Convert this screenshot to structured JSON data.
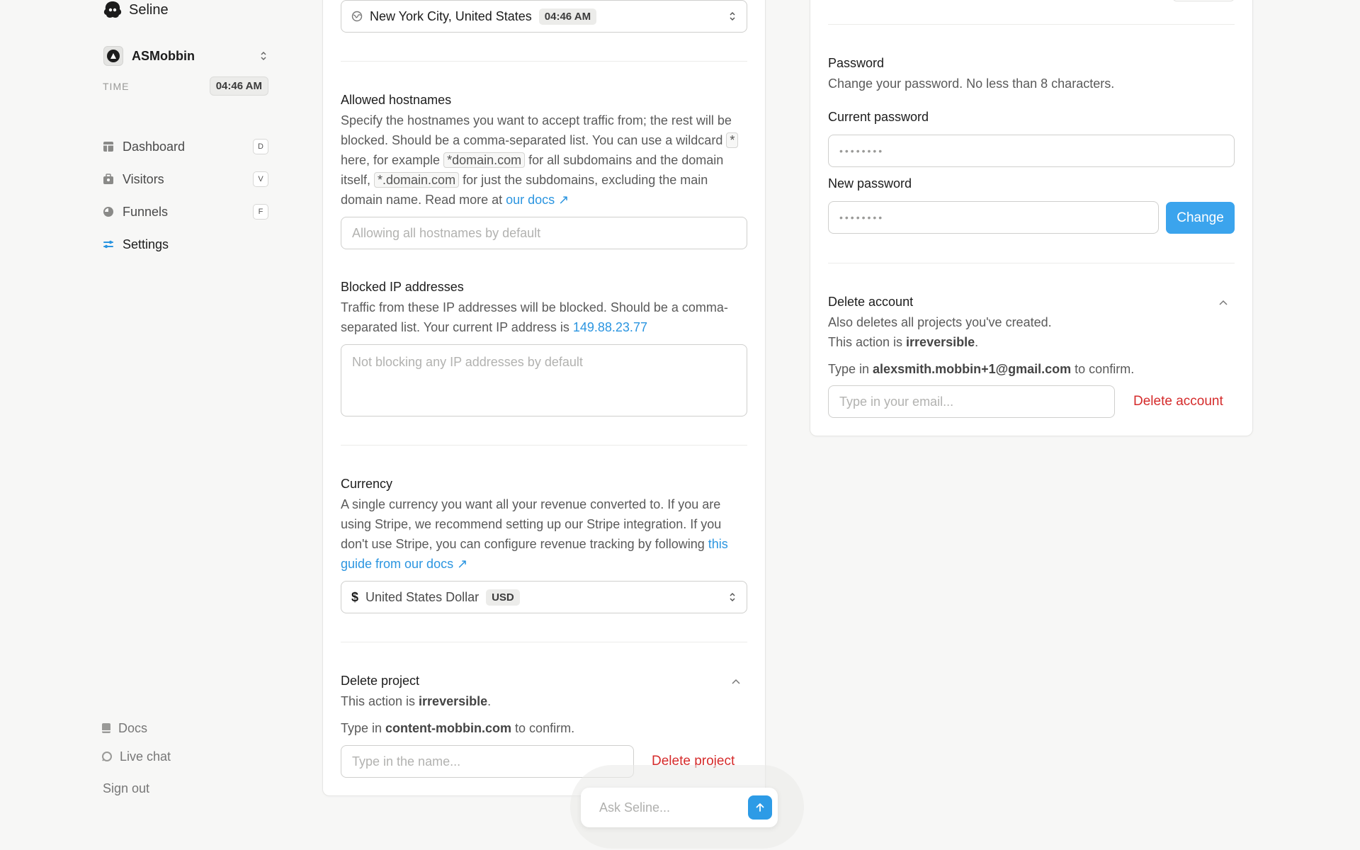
{
  "brand": {
    "name": "Seline"
  },
  "project": {
    "name": "ASMobbin",
    "time_label": "TIME",
    "time_value": "04:46 AM"
  },
  "nav": [
    {
      "label": "Dashboard",
      "key": "D",
      "icon": "dashboard-icon"
    },
    {
      "label": "Visitors",
      "key": "V",
      "icon": "visitors-icon"
    },
    {
      "label": "Funnels",
      "key": "F",
      "icon": "funnels-icon"
    },
    {
      "label": "Settings",
      "key": "",
      "icon": "settings-icon"
    }
  ],
  "footer": {
    "docs": "Docs",
    "live_chat": "Live chat",
    "sign_out": "Sign out"
  },
  "timezone": {
    "value": "New York City, United States",
    "time": "04:46 AM"
  },
  "hostnames": {
    "title": "Allowed hostnames",
    "desc_1": "Specify the hostnames you want to accept traffic from; the rest will be blocked. Should be a comma-separated list. You can use a wildcard ",
    "wildcard": "*",
    "desc_2": " here, for example ",
    "example_1": "*domain.com",
    "desc_3": " for all subdomains and the domain itself, ",
    "example_2": "*.domain.com",
    "desc_4": " for just the subdomains, excluding the main domain name. Read more at ",
    "link": "our docs ↗",
    "placeholder": "Allowing all hostnames by default"
  },
  "blocked_ips": {
    "title": "Blocked IP addresses",
    "desc": "Traffic from these IP addresses will be blocked. Should be a comma-separated list. Your current IP address is ",
    "ip": "149.88.23.77",
    "placeholder": "Not blocking any IP addresses by default"
  },
  "currency": {
    "title": "Currency",
    "desc": "A single currency you want all your revenue converted to. If you are using Stripe, we recommend setting up our Stripe integration. If you don't use Stripe, you can configure revenue tracking by following ",
    "link": "this guide from our docs ↗",
    "symbol": "$",
    "value": "United States Dollar",
    "code": "USD"
  },
  "delete_project": {
    "title": "Delete project",
    "desc_prefix": "This action is ",
    "desc_bold": "irreversible",
    "desc_suffix": ".",
    "confirm_prefix": "Type in ",
    "confirm_name": "content-mobbin.com",
    "confirm_suffix": " to confirm.",
    "placeholder": "Type in the name...",
    "button": "Delete project"
  },
  "password": {
    "title": "Password",
    "desc": "Change your password. No less than 8 characters.",
    "current_label": "Current password",
    "new_label": "New password",
    "mask": "••••••••",
    "button": "Change"
  },
  "delete_account": {
    "title": "Delete account",
    "desc_1": "Also deletes all projects you've created.",
    "desc_2_prefix": "This action is ",
    "desc_2_bold": "irreversible",
    "desc_2_suffix": ".",
    "confirm_prefix": "Type in ",
    "confirm_email": "alexsmith.mobbin+1@gmail.com",
    "confirm_suffix": " to confirm.",
    "placeholder": "Type in your email...",
    "button": "Delete account"
  },
  "ask": {
    "placeholder": "Ask Seline..."
  },
  "colors": {
    "accent": "#3ba4ed",
    "danger": "#d52b2b",
    "link": "#2b95e0"
  }
}
